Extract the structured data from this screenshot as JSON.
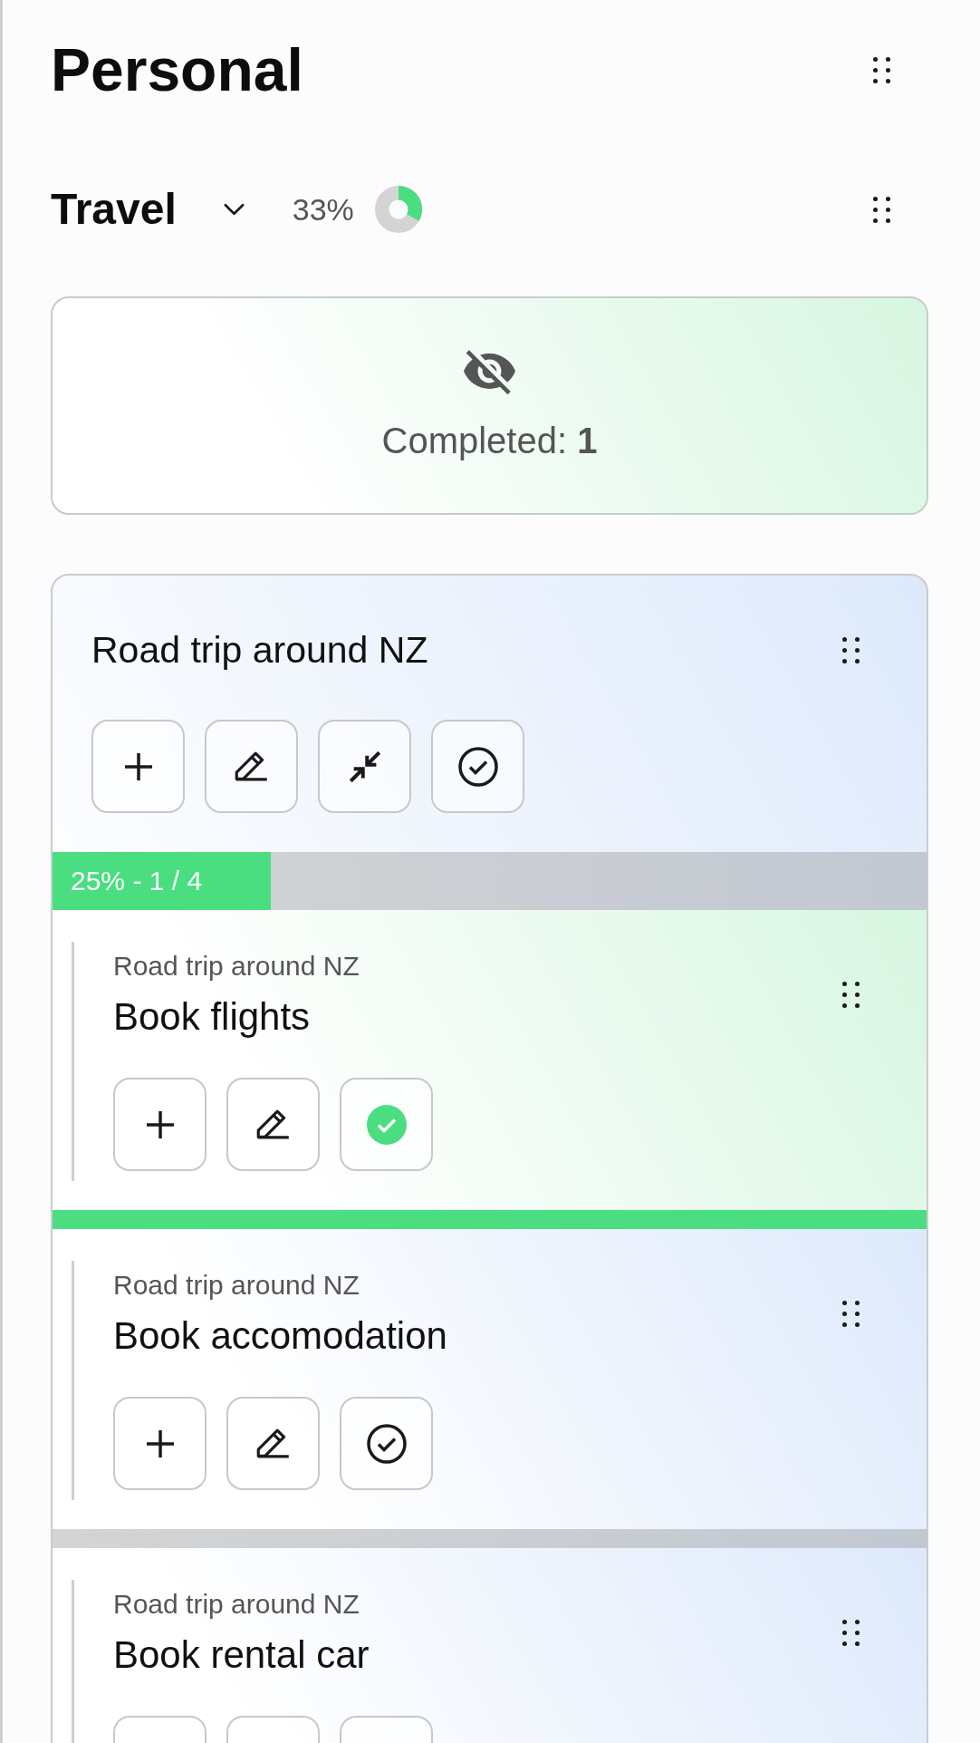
{
  "page": {
    "title": "Personal"
  },
  "category": {
    "name": "Travel",
    "expanded": true,
    "progress": {
      "reading": "33%",
      "level": 0.33
    },
    "completed": {
      "label": "Completed: **1**",
      "visible": false
    },
    "tasks": [
      {
        "title": "Road trip around NZ",
        "expanded": true,
        "done": false,
        "progress": {
          "label": "25% - 1 / 4",
          "level": 0.25
        },
        "children": [
          {
            "parent": "Road trip around NZ",
            "title": "Book flights",
            "done": true,
            "level": 1
          },
          {
            "parent": "Road trip around NZ",
            "title": "Book accomodation",
            "done": false,
            "level": 0
          },
          {
            "parent": "Road trip around NZ",
            "title": "Book rental car",
            "done": false
          }
        ]
      }
    ]
  }
}
